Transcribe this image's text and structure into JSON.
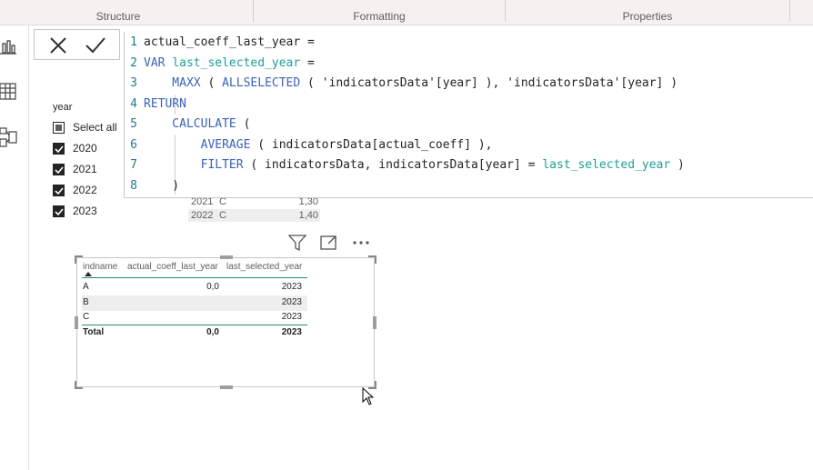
{
  "ribbon": {
    "tabs": [
      {
        "label": "Structure"
      },
      {
        "label": "Formatting"
      },
      {
        "label": "Properties"
      }
    ]
  },
  "rail": {
    "icons": [
      "report-view-icon",
      "table-view-icon",
      "model-view-icon"
    ]
  },
  "editor": {
    "cancel_icon": "close-icon",
    "commit_icon": "checkmark-icon",
    "lines": [
      {
        "num": "1",
        "tokens": [
          {
            "t": "actual_coeff_last_year =",
            "c": "plain"
          }
        ]
      },
      {
        "num": "2",
        "tokens": [
          {
            "t": "VAR ",
            "c": "kw"
          },
          {
            "t": "last_selected_year",
            "c": "var"
          },
          {
            "t": " =",
            "c": "plain"
          }
        ]
      },
      {
        "num": "3",
        "tokens": [
          {
            "t": "    MAXX",
            "c": "fn"
          },
          {
            "t": " ( ",
            "c": "plain"
          },
          {
            "t": "ALLSELECTED",
            "c": "fn"
          },
          {
            "t": " ( ",
            "c": "plain"
          },
          {
            "t": "'indicatorsData'[year]",
            "c": "plain"
          },
          {
            "t": " ), ",
            "c": "plain"
          },
          {
            "t": "'indicatorsData'[year]",
            "c": "plain"
          },
          {
            "t": " )",
            "c": "plain"
          }
        ]
      },
      {
        "num": "4",
        "tokens": [
          {
            "t": "RETURN",
            "c": "kw"
          }
        ]
      },
      {
        "num": "5",
        "tokens": [
          {
            "t": "    CALCULATE",
            "c": "fn"
          },
          {
            "t": " (",
            "c": "plain"
          }
        ]
      },
      {
        "num": "6",
        "tokens": [
          {
            "t": "        AVERAGE",
            "c": "fn"
          },
          {
            "t": " ( indicatorsData[actual_coeff] ),",
            "c": "plain"
          }
        ]
      },
      {
        "num": "7",
        "tokens": [
          {
            "t": "        FILTER",
            "c": "fn"
          },
          {
            "t": " ( indicatorsData, indicatorsData[year] = ",
            "c": "plain"
          },
          {
            "t": "last_selected_year",
            "c": "var"
          },
          {
            "t": " )",
            "c": "plain"
          }
        ]
      },
      {
        "num": "8",
        "tokens": [
          {
            "t": "    )",
            "c": "plain"
          }
        ]
      }
    ]
  },
  "slicer": {
    "title": "year",
    "items": [
      {
        "label": "Select all",
        "state": "partial"
      },
      {
        "label": "2020",
        "state": "checked"
      },
      {
        "label": "2021",
        "state": "checked"
      },
      {
        "label": "2022",
        "state": "checked"
      },
      {
        "label": "2023",
        "state": "checked"
      }
    ]
  },
  "background_table": {
    "rows": [
      {
        "year": "2021",
        "ind": "C",
        "val": "1,30"
      },
      {
        "year": "2022",
        "ind": "C",
        "val": "1,40"
      }
    ]
  },
  "visual_toolbar": {
    "icons": [
      "filter-icon",
      "focus-mode-icon",
      "more-options-icon"
    ]
  },
  "table": {
    "headers": [
      "indname",
      "actual_coeff_last_year",
      "last_selected_year"
    ],
    "rows": [
      {
        "indname": "A",
        "actual": "0,0",
        "last": "2023"
      },
      {
        "indname": "B",
        "actual": "",
        "last": "2023"
      },
      {
        "indname": "C",
        "actual": "",
        "last": "2023"
      }
    ],
    "total": {
      "label": "Total",
      "actual": "0,0",
      "last": "2023"
    }
  },
  "colors": {
    "keyword": "#3a63b8",
    "variable": "#1e9e98",
    "line_number": "#237893",
    "table_accent": "#2b8a82"
  }
}
